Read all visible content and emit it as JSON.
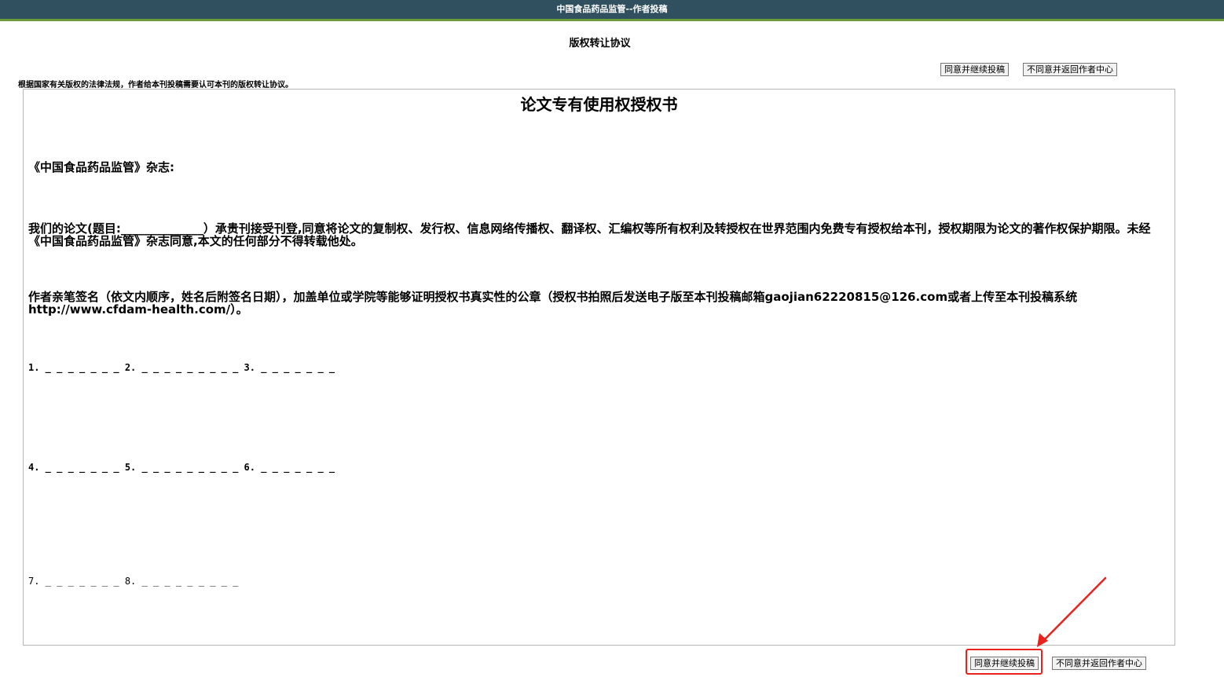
{
  "header": {
    "title": "中国食品药品监管--作者投稿"
  },
  "page": {
    "title": "版权转让协议",
    "notice": "根据国家有关版权的法律法规，作者给本刊投稿需要认可本刊的版权转让协议。"
  },
  "top_buttons": {
    "agree": "同意并继续投稿",
    "disagree": "不同意并返回作者中心"
  },
  "document": {
    "title": "论文专有使用权授权书",
    "greeting": "《中国食品药品监管》杂志:",
    "paragraph1": "    我们的论文(题目:______________）承贵刊接受刊登,同意将论文的复制权、发行权、信息网络传播权、翻译权、汇编权等所有权利及转授权在世界范围内免费专有授权给本刊，授权期限为论文的著作权保护期限。未经《中国食品药品监管》杂志同意,本文的任何部分不得转载他处。",
    "paragraph2": "作者亲笔签名（依文内顺序，姓名后附签名日期），加盖单位或学院等能够证明授权书真实性的公章（授权书拍照后发送电子版至本刊投稿邮箱gaojian62220815@126.com或者上传至本刊投稿系统http://www.cfdam-health.com/）。",
    "sig_row1": "1. _ _ _ _ _ _ _ 2. _ _ _ _ _ _ _ _ _ 3. _ _ _ _ _ _ _",
    "sig_row2": "4. _ _ _ _ _ _ _ 5. _ _ _ _ _ _ _ _ _ 6. _ _ _ _ _ _ _",
    "sig_row3": "7. _ _ _ _ _ _ _ 8. _ _ _ _ _ _ _ _ _"
  },
  "bottom_buttons": {
    "agree": "同意并继续投稿",
    "disagree": "不同意并返回作者中心"
  },
  "colors": {
    "topbar": "#31505f",
    "accent_line": "#6b9b3a",
    "annotation": "#e8231e"
  }
}
